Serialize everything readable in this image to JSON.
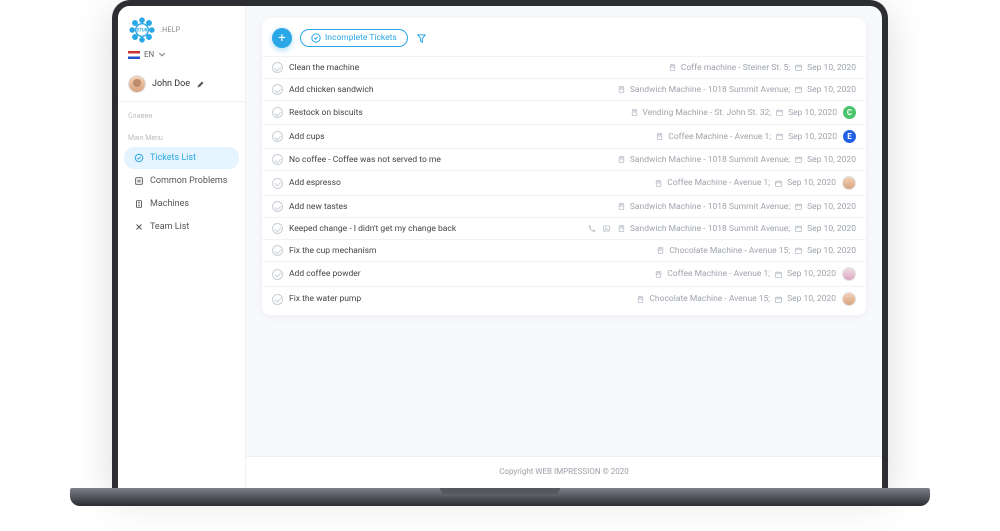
{
  "brand": {
    "title": "STUR",
    "suffix": ".HELP"
  },
  "lang": {
    "code": "EN"
  },
  "user": {
    "name": "John Doe"
  },
  "nav": {
    "city_label": "Сливен",
    "section_label": "Main Menu",
    "items": [
      {
        "label": "Tickets List"
      },
      {
        "label": "Common Problems"
      },
      {
        "label": "Machines"
      },
      {
        "label": "Team List"
      }
    ],
    "active_index": 0
  },
  "toolbar": {
    "add_label": "+",
    "pill_label": "Incomplete Tickets"
  },
  "tickets": [
    {
      "title": "Clean the machine",
      "machine": "Coffe machine - Steiner St. 5;",
      "date": "Sep 10, 2020"
    },
    {
      "title": "Add chicken sandwich",
      "machine": "Sandwich Machine - 1018 Summit Avenue;",
      "date": "Sep 10, 2020"
    },
    {
      "title": "Restock on biscuits",
      "machine": "Vending Machine - St. John St. 32;",
      "date": "Sep 10, 2020",
      "badge": "C"
    },
    {
      "title": "Add cups",
      "machine": "Coffee Machine - Avenue 1;",
      "date": "Sep 10, 2020",
      "badge": "E"
    },
    {
      "title": "No coffee - Coffee was not served to me",
      "machine": "Sandwich Machine - 1018 Summit Avenue;",
      "date": "Sep 10, 2020"
    },
    {
      "title": "Add espresso",
      "machine": "Coffee Machine - Avenue 1;",
      "date": "Sep 10, 2020",
      "assignee": "m"
    },
    {
      "title": "Add new tastes",
      "machine": "Sandwich Machine - 1018 Summit Avenue;",
      "date": "Sep 10, 2020"
    },
    {
      "title": "Keeped change - I didn't get my change back",
      "machine": "Sandwich Machine - 1018 Summit Avenue;",
      "date": "Sep 10, 2020",
      "extras": [
        "phone",
        "image"
      ]
    },
    {
      "title": "Fix the cup mechanism",
      "machine": "Chocolate Machine - Avenue 15;",
      "date": "Sep 10, 2020"
    },
    {
      "title": "Add coffee powder",
      "machine": "Coffee Machine - Avenue 1;",
      "date": "Sep 10, 2020",
      "assignee": "f"
    },
    {
      "title": "Fix the water pump",
      "machine": "Chocolate Machine - Avenue 15;",
      "date": "Sep 10, 2020",
      "assignee": "m"
    }
  ],
  "footer": "Copyright WEB IMPRESSION © 2020"
}
